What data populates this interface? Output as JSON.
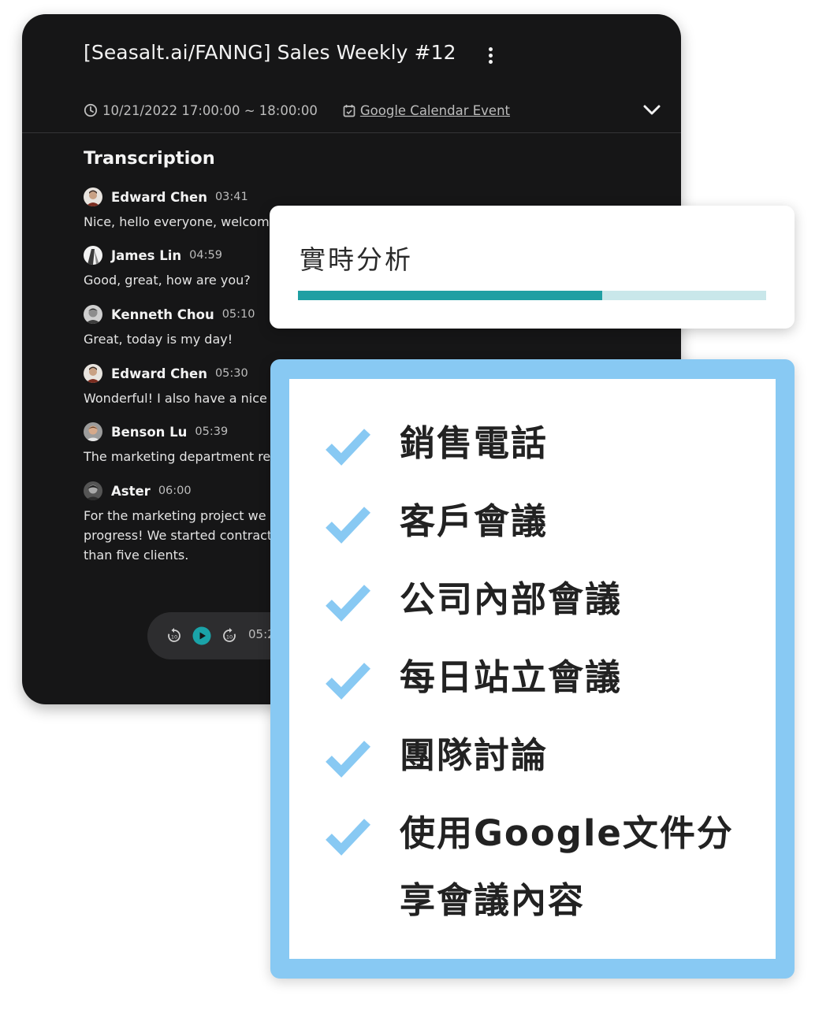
{
  "meeting": {
    "title": "[Seasalt.ai/FANNG] Sales Weekly #12",
    "time_range": "10/21/2022 17:00:00 ~ 18:00:00",
    "calendar_link": "Google Calendar Event",
    "section_title": "Transcription",
    "entries": [
      {
        "speaker": "Edward Chen",
        "time": "03:41",
        "text": "Nice, hello everyone, welcome"
      },
      {
        "speaker": "James Lin",
        "time": "04:59",
        "text": "Good, great, how are you?"
      },
      {
        "speaker": "Kenneth Chou",
        "time": "05:10",
        "text": "Great, today is my day!"
      },
      {
        "speaker": "Edward Chen",
        "time": "05:30",
        "text": "Wonderful! I also have a nice"
      },
      {
        "speaker": "Benson Lu",
        "time": "05:39",
        "text": "The marketing department re"
      },
      {
        "speaker": "Aster",
        "time": "06:00",
        "text_lines": [
          "For the marketing project we",
          "progress! We started contract",
          "than five clients."
        ]
      }
    ],
    "player": {
      "current_time": "05:2",
      "rewind_icon": "rewind-icon",
      "play_icon": "play-icon",
      "forward_icon": "forward-icon"
    }
  },
  "analysis": {
    "title": "實時分析",
    "progress": 0.65,
    "colors": {
      "fill": "#1f9fa3",
      "track": "#c9e7ea"
    }
  },
  "features": {
    "check_icon": "checkmark-icon",
    "check_color": "#88c9f3",
    "items": [
      {
        "label": "銷售電話"
      },
      {
        "label": "客戶會議"
      },
      {
        "label": "公司內部會議"
      },
      {
        "label": "每日站立會議"
      },
      {
        "label": "團隊討論"
      },
      {
        "label": "使用Google文件分享會議內容"
      }
    ]
  }
}
